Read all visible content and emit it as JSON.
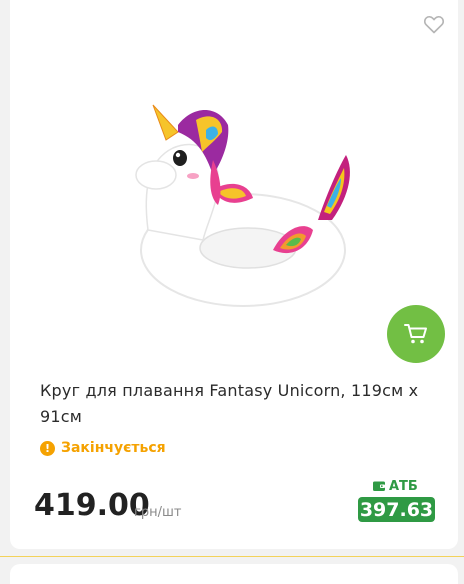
{
  "product": {
    "title": "Круг для плавання Fantasy Unicorn, 119см х 91см",
    "status": "Закінчується",
    "price": "419.00",
    "unit": "грн/шт",
    "club_label": "АТБ",
    "club_price": "397.63"
  },
  "icons": {
    "favorite": "heart-outline-icon",
    "cart": "shopping-cart-icon",
    "status": "exclamation-icon",
    "club": "wallet-icon"
  },
  "colors": {
    "accent_green": "#72bf44",
    "club_green": "#2f9a44",
    "warning_orange": "#f5a201",
    "divider_yellow": "#f3d25a"
  }
}
